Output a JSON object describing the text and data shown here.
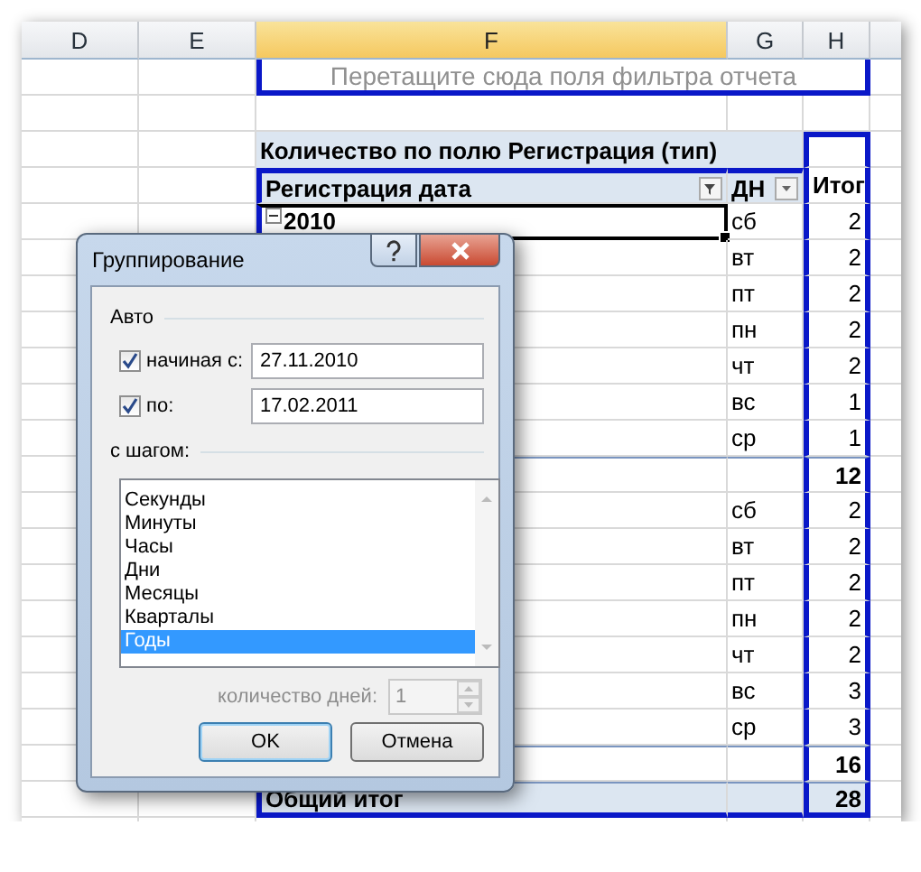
{
  "sheet": {
    "columns": [
      {
        "label": "D",
        "selected": false
      },
      {
        "label": "E",
        "selected": false
      },
      {
        "label": "F",
        "selected": true
      },
      {
        "label": "G",
        "selected": false
      },
      {
        "label": "H",
        "selected": false
      }
    ],
    "filter_hint": "Перетащите сюда поля фильтра отчета",
    "pivot": {
      "title": "Количество по полю Регистрация (тип)",
      "row_header": "Регистрация дата",
      "column_header": "ДН",
      "total_header": "Итог",
      "rows": [
        {
          "kind": "group",
          "label": "2010",
          "expanded": true,
          "active": true,
          "day": "сб",
          "count": "2"
        },
        {
          "kind": "item",
          "day": "вт",
          "count": "2"
        },
        {
          "kind": "item",
          "day": "пт",
          "count": "2"
        },
        {
          "kind": "item",
          "day": "пн",
          "count": "2"
        },
        {
          "kind": "item",
          "day": "чт",
          "count": "2"
        },
        {
          "kind": "item",
          "day": "вс",
          "count": "1"
        },
        {
          "kind": "item",
          "day": "ср",
          "count": "1"
        },
        {
          "kind": "subtotal",
          "count": "12"
        },
        {
          "kind": "item",
          "day": "сб",
          "count": "2"
        },
        {
          "kind": "item",
          "day": "вт",
          "count": "2"
        },
        {
          "kind": "item",
          "day": "пт",
          "count": "2"
        },
        {
          "kind": "item",
          "day": "пн",
          "count": "2"
        },
        {
          "kind": "item",
          "day": "чт",
          "count": "2"
        },
        {
          "kind": "item",
          "day": "вс",
          "count": "3"
        },
        {
          "kind": "item",
          "day": "ср",
          "count": "3"
        },
        {
          "kind": "subtotal",
          "count": "16"
        },
        {
          "kind": "grand",
          "label": "Общий итог",
          "count": "28"
        }
      ]
    }
  },
  "dialog": {
    "title": "Группирование",
    "auto_label": "Авто",
    "bounds": [
      {
        "label": "начиная с:",
        "checked": true,
        "value": "27.11.2010"
      },
      {
        "label": "по:",
        "checked": true,
        "value": "17.02.2011"
      }
    ],
    "step_label": "с шагом:",
    "steps": [
      {
        "label": "Секунды",
        "selected": false
      },
      {
        "label": "Минуты",
        "selected": false
      },
      {
        "label": "Часы",
        "selected": false
      },
      {
        "label": "Дни",
        "selected": false
      },
      {
        "label": "Месяцы",
        "selected": false
      },
      {
        "label": "Кварталы",
        "selected": false
      },
      {
        "label": "Годы",
        "selected": true
      }
    ],
    "days": {
      "label": "количество дней:",
      "value": "1",
      "disabled": true
    },
    "buttons": [
      {
        "label": "OK",
        "default": true
      },
      {
        "label": "Отмена",
        "default": false
      }
    ]
  }
}
